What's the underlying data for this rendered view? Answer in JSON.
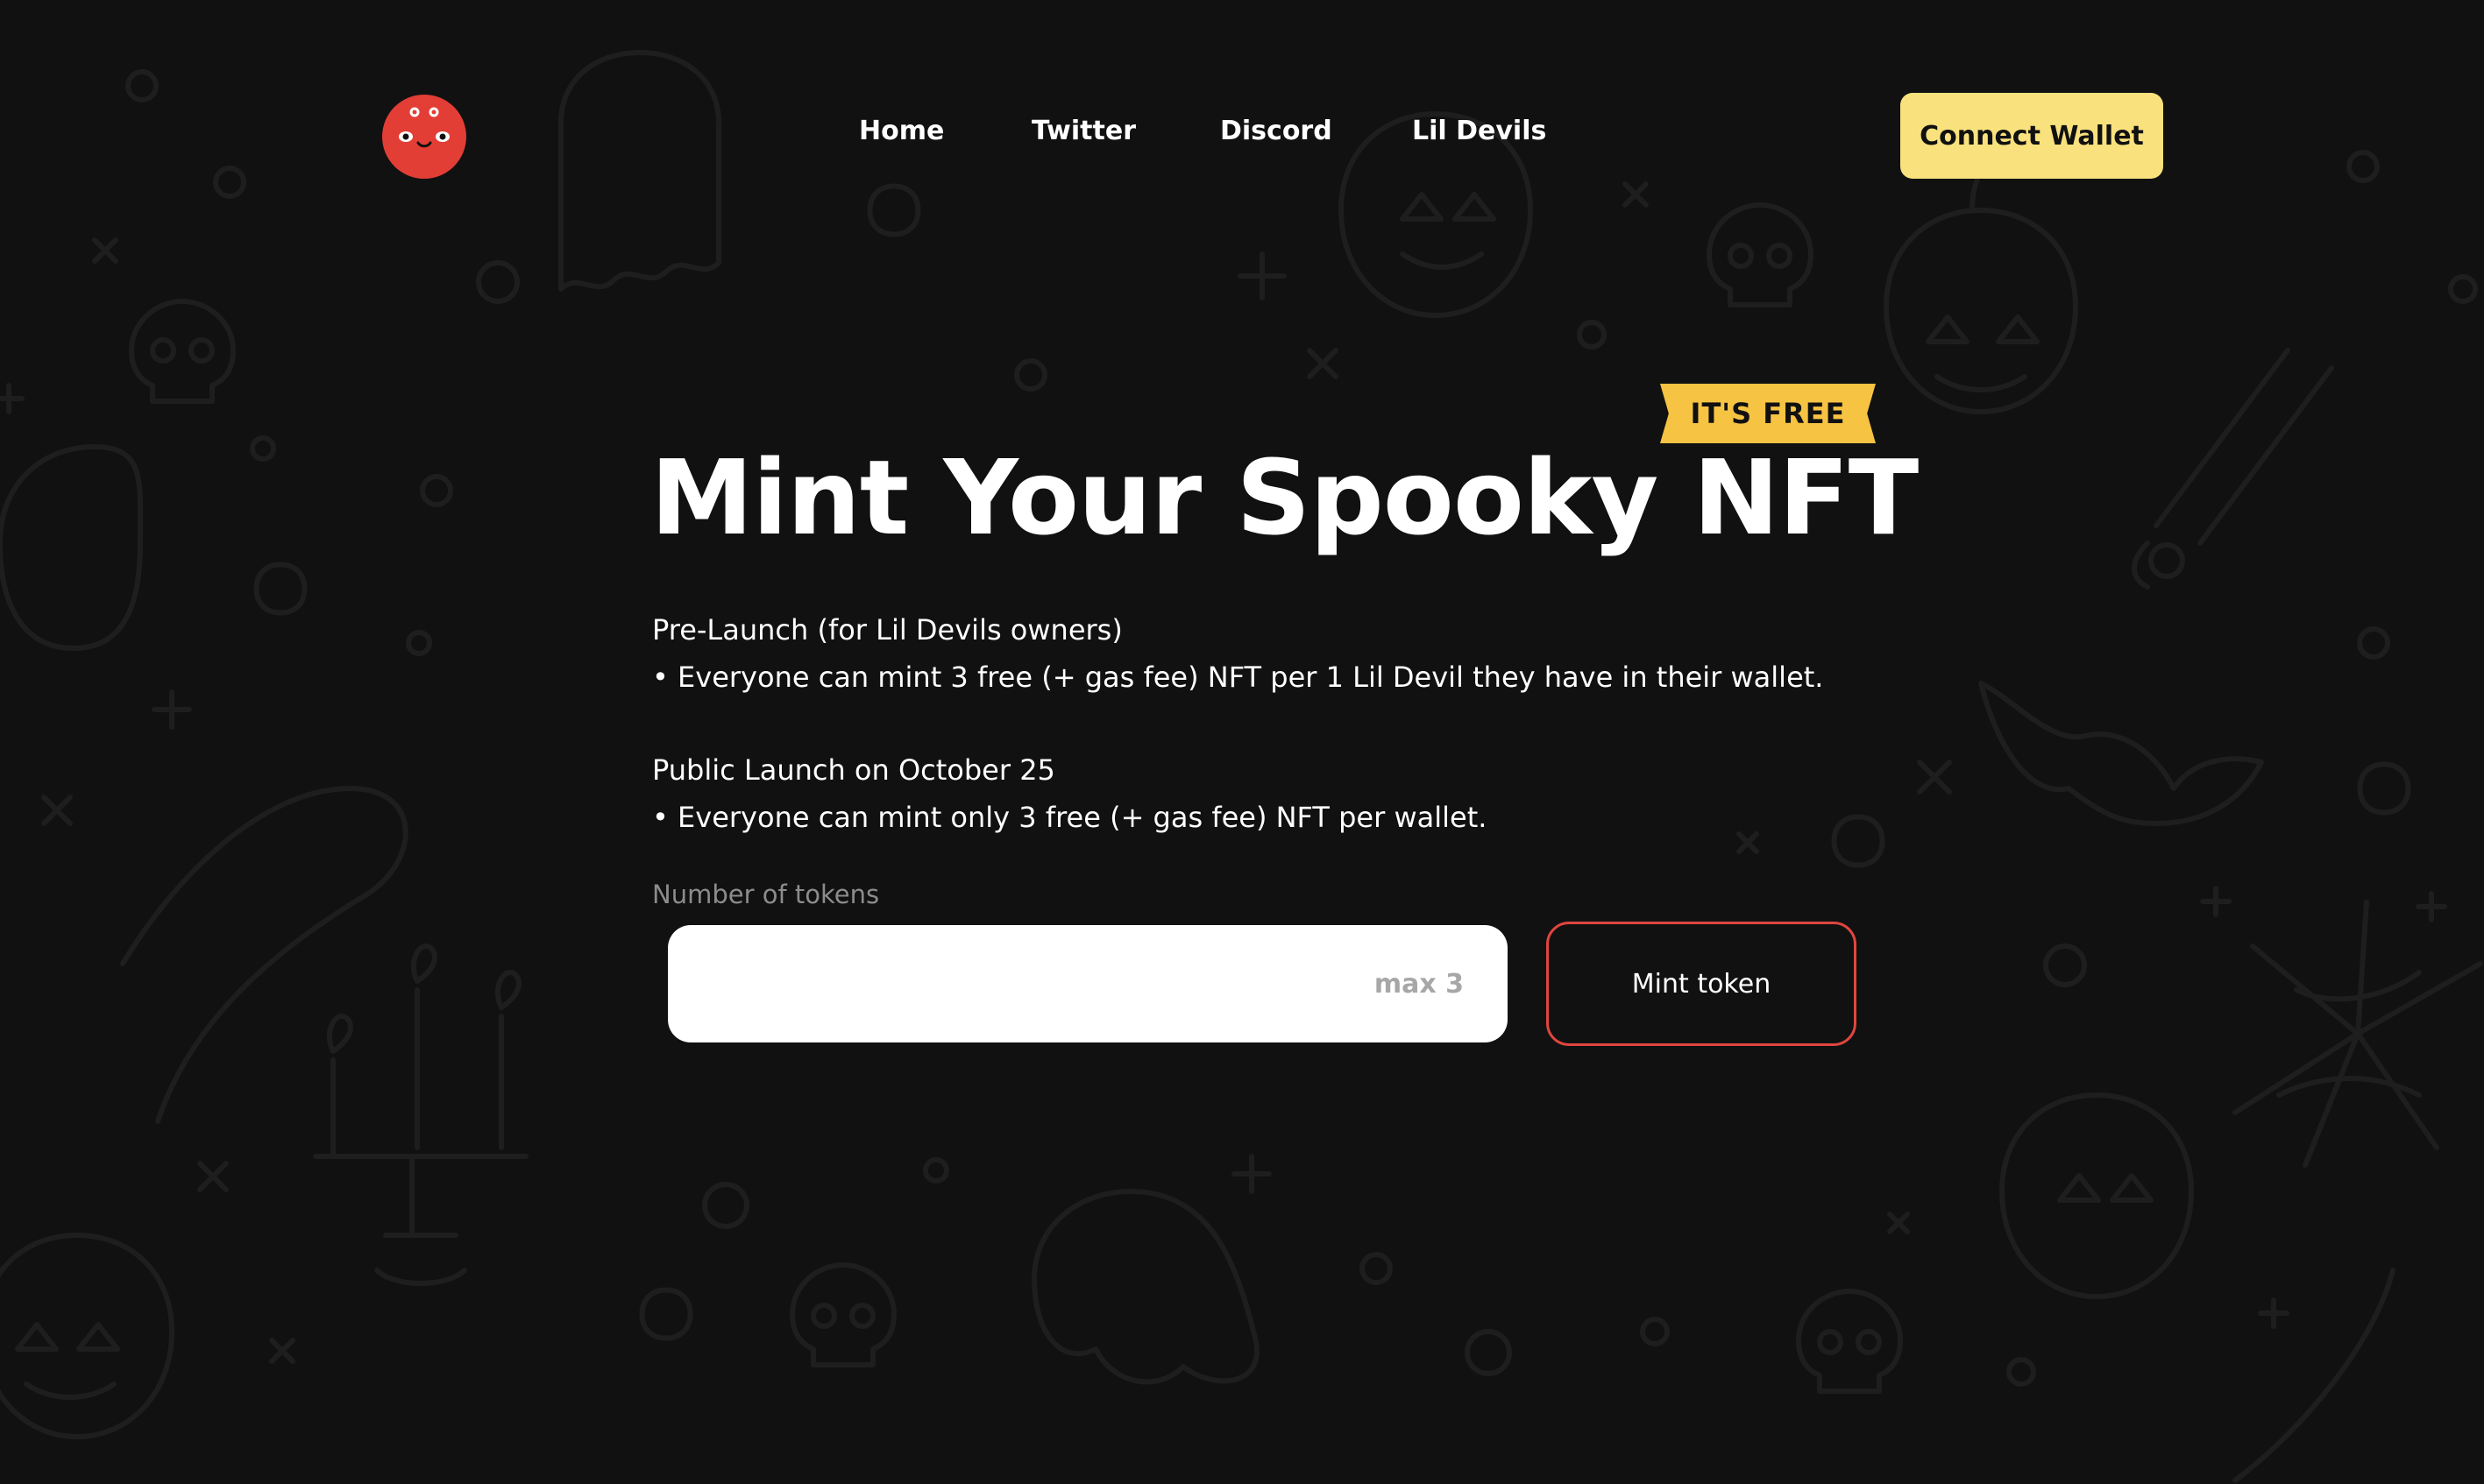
{
  "header": {
    "nav": [
      {
        "label": "Home"
      },
      {
        "label": "Twitter"
      },
      {
        "label": "Discord"
      },
      {
        "label": "Lil Devils"
      }
    ],
    "connect_wallet_label": "Connect Wallet"
  },
  "hero": {
    "badge": "IT'S FREE",
    "title": "Mint Your Spooky NFT",
    "prelaunch": {
      "heading": "Pre-Launch (for Lil Devils owners)",
      "bullet": "• Everyone can mint 3 free (+ gas fee) NFT per 1 Lil Devil they have in their wallet."
    },
    "public": {
      "heading": "Public Launch on October 25",
      "bullet": "• Everyone can mint only 3 free (+ gas fee) NFT per wallet."
    }
  },
  "mint_form": {
    "label": "Number of tokens",
    "value": "",
    "placeholder": "max 3",
    "button_label": "Mint token"
  },
  "colors": {
    "background": "#111111",
    "logo": "#e23e36",
    "connect_button": "#f9e27d",
    "badge": "#f6c343",
    "mint_border": "#e0463f"
  },
  "icons": [
    "devil-logo-icon"
  ]
}
